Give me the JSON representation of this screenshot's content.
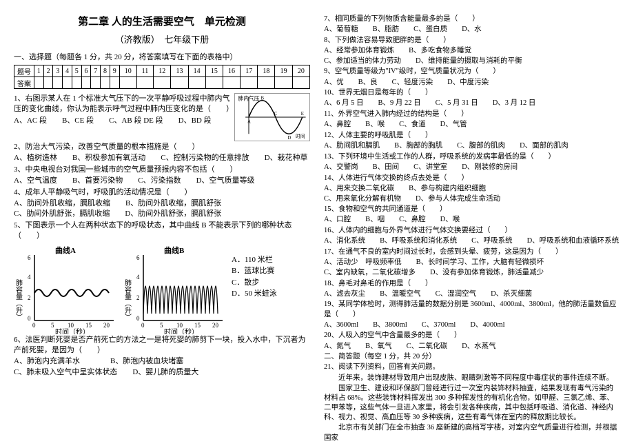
{
  "header": {
    "title": "第二章 人的生活需要空气　单元检测",
    "subtitle": "（济教版）　七年级下册"
  },
  "sectionA": "一、选择题（每题各 1 分，共 20 分，将答案填写在下面的表格中）",
  "answer_table": {
    "row_label_q": "题号",
    "row_label_a": "答案",
    "nums": [
      "1",
      "2",
      "3",
      "4",
      "5",
      "6",
      "7",
      "8",
      "9",
      "10",
      "11",
      "12",
      "13",
      "14",
      "15",
      "16",
      "17",
      "18",
      "19",
      "20"
    ]
  },
  "q1": {
    "text": "1、右图示某人在 1 个标准大气压下的一次平静呼吸过程中肺内气压的变化曲线，你认为能表示呼气过程中肺内压变化的是（　　）",
    "opts": "A、AC 段　　B、CE 段　　C、AB 段 DE 段　　D、BD 段",
    "wave_ylabel": "肺内气压",
    "wave_xlabel": "时间",
    "wave_pts": [
      "A",
      "B",
      "C",
      "D",
      "E"
    ]
  },
  "q2": {
    "text": "2、防治大气污染，改善空气质量的根本措施是（　　）",
    "opts": "A、植树造林　　B、积极参加有氧活动　　C、控制污染物的任意排放　　D、栽花种草"
  },
  "q3": {
    "text": "3、中央电视台对我国一些城市的空气质量预报内容不包括（　　）",
    "opts": "A、空气温度　　B、首要污染物　　C、污染指数　　D、空气质量等级"
  },
  "q4": {
    "text": "4、成年人平静吸气时，呼吸肌的活动情况是（　　）",
    "opts": "A、肋间外肌收缩，膈肌收缩　　B、肋间外肌收缩，膈肌舒张\nC、肋间外肌舒张，膈肌收缩　　D、肋间外肌舒张，膈肌舒张"
  },
  "q5": {
    "text": "5、下图表示一个人在两种状态下的呼吸状态，其中曲线 B 不能表示下列的哪种状态（　　）",
    "chartA_title": "曲线A",
    "chartB_title": "曲线B",
    "ylabel": "肺容量（升）",
    "xlabel": "时间（秒）",
    "xticks": [
      "0",
      "5",
      "10",
      "15",
      "20"
    ],
    "opts": {
      "A": "A．110 米栏",
      "B": "B．篮球比赛",
      "C": "C．散步",
      "D": "D．50 米蛙泳"
    }
  },
  "q6": {
    "text": "6、法医判断死婴是否产前死亡的方法之一是将死婴的肺剪下一块，投入水中，下沉者为产前死婴，是因为（　　）",
    "opts": "A、肺泡内充满羊水　　　　B、肺泡内被血块堵塞\nC、肺未吸入空气中呈实体状态　　D、婴儿肺的质量大"
  },
  "right": {
    "q7": "7、相同质量的下列物质含能量最多的是（　　）",
    "q7o": "A、葡萄糖　　B、脂肪　　C、蛋白质　　D、水",
    "q8": "8、下列做法容易导致肥胖的是（　　）",
    "q8o": "A、经常参加体育锻炼　　B、多吃食物多睡觉\nC、参加适当的体力劳动　　D、维持能量的摄取与消耗的平衡",
    "q9": "9、空气质量等级为\"IV\"级时，空气质量状况为（　　）",
    "q9o": "A、优　　B、良　　C、轻度污染　　D、中度污染",
    "q10": "10、世界无烟日是每年的（　　）",
    "q10o": "A、6 月 5 日　　B、9 月 22 日　　C、5 月 31 日　　D、3 月 12 日",
    "q11": "11、外界空气进入肺内经过的结构是（　　）",
    "q11o": "A、鼻腔　　B、喉　　C、食道　　D、气管",
    "q12": "12、人体主要的呼吸肌是（　　）",
    "q12o": "A、肋间肌和膈肌　　B、胸部的胸肌　　C、腹部的肌肉　　D、面部的肌肉",
    "q13": "13、下列环境中生活或工作的人群，呼吸系统的发病率最低的是（　　）",
    "q13o": "A、交警岗　　B、田间　　C、讲堂室　　D、刚装修的房间",
    "q14": "14、人体进行气体交换的终点去处是（　　）",
    "q14o": "A、用来交换二氧化碳　　B、参与构建内组织细胞\nC、用来氧化分解有机物　　D、参与人体完成生命活动",
    "q15": "15、食物和空气的共同通道是（　　）",
    "q15o": "A、口腔　　B、咽　　C、鼻腔　　D、喉",
    "q16": "16、人体内的细胞与外界气体进行气体交换要经过（　　）",
    "q16o": "A、消化系统　　B、呼吸系统和消化系统　　C、呼吸系统　　D、呼吸系统和血液循环系统",
    "q17": "17、在通气不良的室内时间过长时，会感到头晕、疲劳，这是因为（　　）",
    "q17o": "A、活动少　呼吸频率低　　B、长时间学习、工作，大脑有轻微损坏\nC、室内缺氧，二氧化碳增多　　D、没有参加体育锻炼，肺活量减少",
    "q18": "18、鼻毛对鼻毛的作用是（　　）",
    "q18o": "A、滤去灰尘　　B、温暖空气　　C、湿润空气　　D、杀灭细菌",
    "q19": "19、某同学体检时，测得肺活量的数据分别是 3600ml、4000ml、3800ml，他的肺活量数值应是（　　）",
    "q19o": "A、3600ml　　B、3800ml　　C、3700ml　　D、4000ml",
    "q20": "20、人吸入的空气中含量最多的是（　　）",
    "q20o": "A、氮气　　B、氧气　　C、二氧化碳　　D、水蒸气",
    "sectionB": "二、简答题（每空 1 分，共 20 分）",
    "q21": "21、阅读下列资料，回答有关问题。",
    "p1": "　　近年来，装饰建材导致用户出现皮肤、眼睛刺激等不同程度中毒症状的事件连续不断。",
    "p2": "　　国家卫生、建设和环保部门曾经进行过一次室内装饰材料抽查，结果发现有毒气污染的材料占 68%。这些装饰材料挥发出 300 多种挥发性的有机化合物，如甲醛、三氯乙烯、苯、二甲苯等，这些气体一旦进入家里，将会引发各种疾病，其中包括呼吸道、消化道、神经内科、视力、视觉、高血压等 30 多种疾病，这些有毒气体在室内的释放期比较长。",
    "p3": "　　北京市有关部门在全市抽查 36 座新建的高档写字楼，对室内空气质量进行检测，并根据国家"
  },
  "chart_data": [
    {
      "type": "line",
      "name": "q1-breathing-pressure-wave",
      "x": [
        0,
        1,
        2,
        3,
        4
      ],
      "labels": [
        "A",
        "B",
        "C",
        "D",
        "E"
      ],
      "y": [
        0,
        1,
        0,
        -1,
        0
      ],
      "xlabel": "时间",
      "ylabel": "肺内气压",
      "title": ""
    },
    {
      "type": "line",
      "name": "curve-A",
      "title": "曲线A",
      "x": [
        0,
        5,
        10,
        15,
        20
      ],
      "y_approx_amplitude": 0.5,
      "y_midline": 2.5,
      "period_seconds": 4,
      "xlabel": "时间（秒）",
      "ylabel": "肺容量（升）",
      "ylim": [
        0,
        6
      ]
    },
    {
      "type": "line",
      "name": "curve-B",
      "title": "曲线B",
      "x": [
        0,
        5,
        10,
        15,
        20
      ],
      "y_approx_amplitude": 2.5,
      "y_midline": 3,
      "period_seconds": 2,
      "xlabel": "时间（秒）",
      "ylabel": "肺容量（升）",
      "ylim": [
        0,
        6
      ]
    }
  ]
}
